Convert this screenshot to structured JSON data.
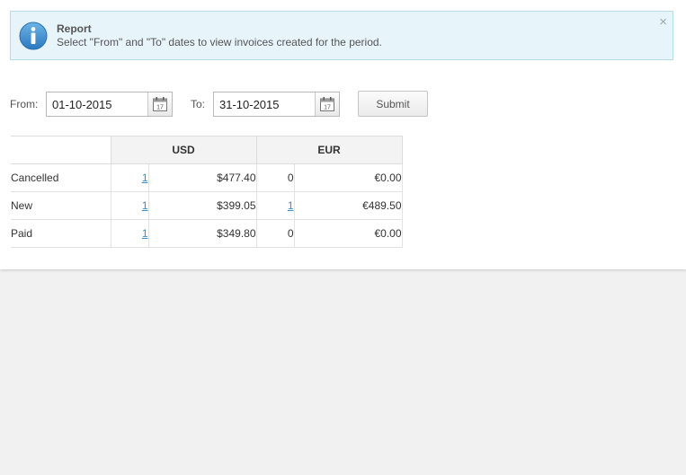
{
  "alert": {
    "title": "Report",
    "message": "Select \"From\" and \"To\" dates to view invoices created for the period.",
    "close_glyph": "×",
    "icon": "info-icon"
  },
  "filters": {
    "from_label": "From:",
    "from_value": "01-10-2015",
    "to_label": "To:",
    "to_value": "31-10-2015",
    "calendar_icon": "calendar-icon",
    "submit_label": "Submit"
  },
  "table": {
    "currencies": [
      "USD",
      "EUR"
    ],
    "rows": [
      {
        "label": "Cancelled",
        "usd_count": "1",
        "usd_amount": "$477.40",
        "eur_count": "0",
        "eur_amount": "€0.00"
      },
      {
        "label": "New",
        "usd_count": "1",
        "usd_amount": "$399.05",
        "eur_count": "1",
        "eur_amount": "€489.50"
      },
      {
        "label": "Paid",
        "usd_count": "1",
        "usd_amount": "$349.80",
        "eur_count": "0",
        "eur_amount": "€0.00"
      }
    ]
  },
  "colors": {
    "alert_bg": "#e7f4fa",
    "link": "#3a8fc4",
    "icon_blue": "#3c8fcc"
  }
}
